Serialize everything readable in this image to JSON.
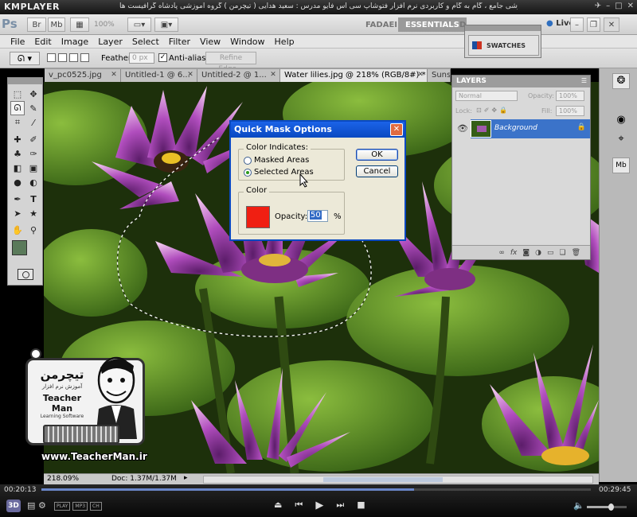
{
  "player": {
    "logo": "KMPLAYER",
    "title": "مجموعه آموزشی جامع ، گام به گام و کاربردی نرم افزار فتوشاپ سی اس فایو  مدرس : سعید هدایی ( تیچرمن ) گروه آموزشی پادشاه گرافیست ها",
    "time_elapsed": "00:20:13",
    "time_total": "00:29:45",
    "badges": [
      "3D",
      "PLAY",
      "MP3",
      "CH"
    ]
  },
  "app_bar": {
    "logo": "Ps",
    "zoom": "100%",
    "workspaces": [
      "FADAEI",
      "ESSENTIALS",
      "D"
    ],
    "cs_live": "Live"
  },
  "menu": [
    "File",
    "Edit",
    "Image",
    "Layer",
    "Select",
    "Filter",
    "View",
    "Window",
    "Help"
  ],
  "options": {
    "feather_label": "Feather:",
    "feather_value": "0 px",
    "antialias_label": "Anti-alias",
    "refine_edge": "Refine Edge..."
  },
  "tabs": [
    {
      "label": "v_pc0525.jpg"
    },
    {
      "label": "Untitled-1 @ 6..."
    },
    {
      "label": "Untitled-2 @ 1..."
    },
    {
      "label": "Water lilies.jpg @ 218% (RGB/8#) *"
    },
    {
      "label": "Sunse"
    }
  ],
  "swatches": {
    "label": "SWATCHES"
  },
  "layers": {
    "title": "LAYERS",
    "blend_mode": "Normal",
    "opacity_label": "Opacity:",
    "opacity_value": "100%",
    "lock_label": "Lock:",
    "fill_label": "Fill:",
    "fill_value": "100%",
    "layer_name": "Background"
  },
  "dialog": {
    "title": "Quick Mask Options",
    "color_indicates_label": "Color Indicates:",
    "masked_areas": "Masked Areas",
    "selected_areas": "Selected Areas",
    "color_label": "Color",
    "opacity_label": "Opacity:",
    "opacity_value": "50",
    "percent": "%",
    "ok": "OK",
    "cancel": "Cancel",
    "mask_color": "#f01f12",
    "selected_option": "selected_areas"
  },
  "status": {
    "zoom": "218.09%",
    "doc": "Doc: 1.37M/1.37M"
  },
  "watermark": {
    "persian_name": "تیچرمن",
    "subtitle": "آموزش نرم افزار",
    "name": "Teacher Man",
    "small": "Learning Software",
    "url": "www.TeacherMan.ir"
  }
}
